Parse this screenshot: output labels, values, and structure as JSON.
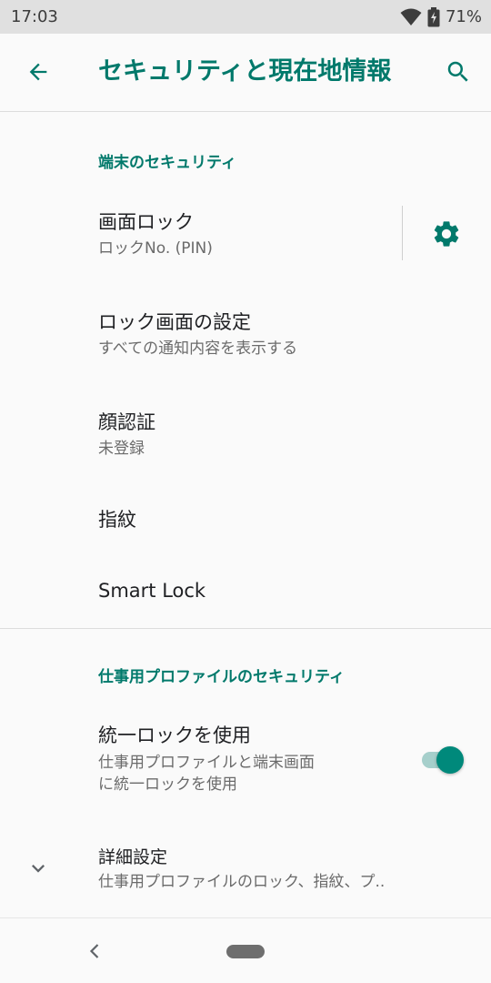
{
  "status_bar": {
    "time": "17:03",
    "battery": "71%"
  },
  "toolbar": {
    "title": "セキュリティと現在地情報",
    "back_icon": "arrow-left-icon",
    "search_icon": "search-icon"
  },
  "device_security": {
    "header": "端末のセキュリティ",
    "items": [
      {
        "title": "画面ロック",
        "summary": "ロックNo. (PIN)",
        "has_settings": true
      },
      {
        "title": "ロック画面の設定",
        "summary": "すべての通知内容を表示する"
      },
      {
        "title": "顔認証",
        "summary": "未登録"
      },
      {
        "title": "指紋"
      },
      {
        "title": "Smart Lock"
      }
    ]
  },
  "work_profile_security": {
    "header": "仕事用プロファイルのセキュリティ",
    "unified_lock": {
      "title": "統一ロックを使用",
      "summary_line1": "仕事用プロファイルと端末画面",
      "summary_line2": "に統一ロックを使用",
      "toggle_on": true
    },
    "advanced": {
      "title": "詳細設定",
      "summary": "仕事用プロファイルのロック、指紋、プ.."
    }
  },
  "colors": {
    "accent": "#00796b",
    "toggle_thumb": "#00897b",
    "toggle_track": "#a6cfcb"
  }
}
